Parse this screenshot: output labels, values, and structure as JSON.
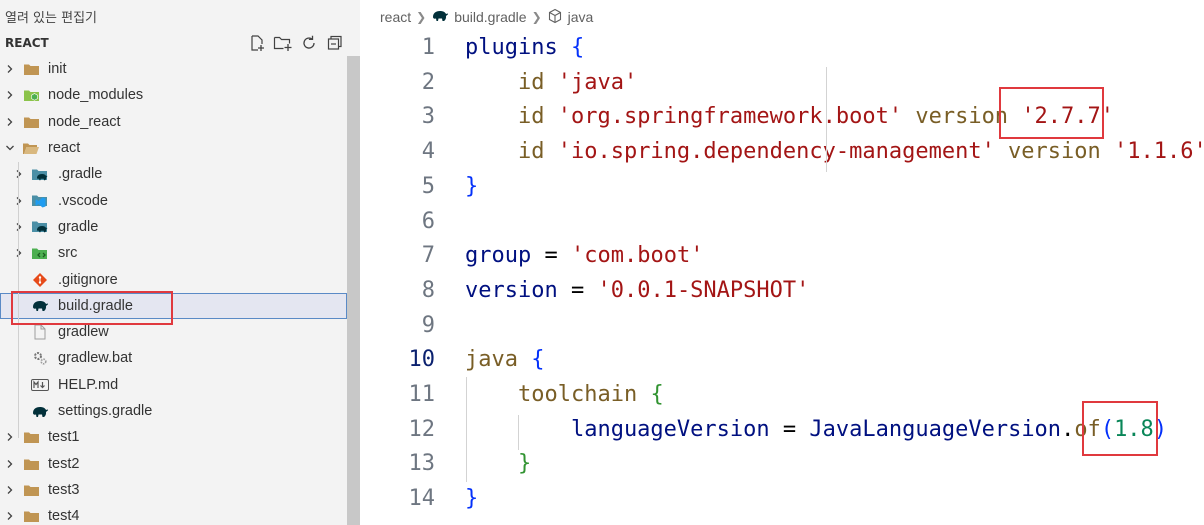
{
  "explorer": {
    "open_editors_label": "열려 있는 편집기",
    "section_title": "REACT",
    "actions": [
      {
        "name": "new-file-icon"
      },
      {
        "name": "new-folder-icon"
      },
      {
        "name": "refresh-icon"
      },
      {
        "name": "collapse-all-icon"
      }
    ],
    "items": [
      {
        "label": "init",
        "level": 0,
        "kind": "folder",
        "expanded": false
      },
      {
        "label": "node_modules",
        "level": 0,
        "kind": "node-folder",
        "expanded": false
      },
      {
        "label": "node_react",
        "level": 0,
        "kind": "folder",
        "expanded": false
      },
      {
        "label": "react",
        "level": 0,
        "kind": "folder-open",
        "expanded": true
      },
      {
        "label": ".gradle",
        "level": 1,
        "kind": "gradle-folder",
        "expanded": false
      },
      {
        "label": ".vscode",
        "level": 1,
        "kind": "vscode-folder",
        "expanded": false
      },
      {
        "label": "gradle",
        "level": 1,
        "kind": "gradle-folder",
        "expanded": false
      },
      {
        "label": "src",
        "level": 1,
        "kind": "src-folder",
        "expanded": false
      },
      {
        "label": ".gitignore",
        "level": 1,
        "kind": "git-file"
      },
      {
        "label": "build.gradle",
        "level": 1,
        "kind": "gradle-file",
        "selected": true
      },
      {
        "label": "gradlew",
        "level": 1,
        "kind": "plain-file"
      },
      {
        "label": "gradlew.bat",
        "level": 1,
        "kind": "gear-file"
      },
      {
        "label": "HELP.md",
        "level": 1,
        "kind": "markdown-file"
      },
      {
        "label": "settings.gradle",
        "level": 1,
        "kind": "gradle-file"
      },
      {
        "label": "test1",
        "level": 0,
        "kind": "folder",
        "expanded": false
      },
      {
        "label": "test2",
        "level": 0,
        "kind": "folder",
        "expanded": false
      },
      {
        "label": "test3",
        "level": 0,
        "kind": "folder",
        "expanded": false
      },
      {
        "label": "test4",
        "level": 0,
        "kind": "folder",
        "expanded": false
      }
    ]
  },
  "breadcrumb": {
    "folder": "react",
    "file": "build.gradle",
    "symbol": "java"
  },
  "editor": {
    "active_line": 10,
    "lines": [
      {
        "n": "1",
        "parts": [
          {
            "t": "plugins ",
            "c": "k-id"
          },
          {
            "t": "{",
            "c": "k-br"
          }
        ]
      },
      {
        "n": "2",
        "parts": [
          {
            "t": "    id ",
            "c": "k-fn"
          },
          {
            "t": "'java'",
            "c": "k-str"
          }
        ]
      },
      {
        "n": "3",
        "parts": [
          {
            "t": "    id ",
            "c": "k-fn"
          },
          {
            "t": "'org.springframework.boot'",
            "c": "k-str"
          },
          {
            "t": " version ",
            "c": "k-fn"
          },
          {
            "t": "'2.7.7'",
            "c": "k-str"
          }
        ]
      },
      {
        "n": "4",
        "parts": [
          {
            "t": "    id ",
            "c": "k-fn"
          },
          {
            "t": "'io.spring.dependency-management'",
            "c": "k-str"
          },
          {
            "t": " version ",
            "c": "k-fn"
          },
          {
            "t": "'1.1.6'",
            "c": "k-str"
          }
        ]
      },
      {
        "n": "5",
        "parts": [
          {
            "t": "}",
            "c": "k-br"
          }
        ]
      },
      {
        "n": "6",
        "parts": []
      },
      {
        "n": "7",
        "parts": [
          {
            "t": "group ",
            "c": "k-id"
          },
          {
            "t": "= ",
            "c": "k-op"
          },
          {
            "t": "'com.boot'",
            "c": "k-str"
          }
        ]
      },
      {
        "n": "8",
        "parts": [
          {
            "t": "version ",
            "c": "k-id"
          },
          {
            "t": "= ",
            "c": "k-op"
          },
          {
            "t": "'0.0.1-SNAPSHOT'",
            "c": "k-str"
          }
        ]
      },
      {
        "n": "9",
        "parts": []
      },
      {
        "n": "10",
        "parts": [
          {
            "t": "java ",
            "c": "k-fn"
          },
          {
            "t": "{",
            "c": "k-br"
          }
        ]
      },
      {
        "n": "11",
        "parts": [
          {
            "t": "    toolchain ",
            "c": "k-fn"
          },
          {
            "t": "{",
            "c": "k-br2"
          }
        ]
      },
      {
        "n": "12",
        "parts": [
          {
            "t": "        languageVersion ",
            "c": "k-id"
          },
          {
            "t": "= ",
            "c": "k-op"
          },
          {
            "t": "JavaLanguageVersion",
            "c": "k-id"
          },
          {
            "t": ".",
            "c": "k-op"
          },
          {
            "t": "of",
            "c": "k-fn"
          },
          {
            "t": "(",
            "c": "k-br"
          },
          {
            "t": "1.8",
            "c": "k-num"
          },
          {
            "t": ")",
            "c": "k-br"
          }
        ]
      },
      {
        "n": "13",
        "parts": [
          {
            "t": "    }",
            "c": "k-br2"
          }
        ]
      },
      {
        "n": "14",
        "parts": [
          {
            "t": "}",
            "c": "k-br"
          }
        ]
      }
    ]
  }
}
